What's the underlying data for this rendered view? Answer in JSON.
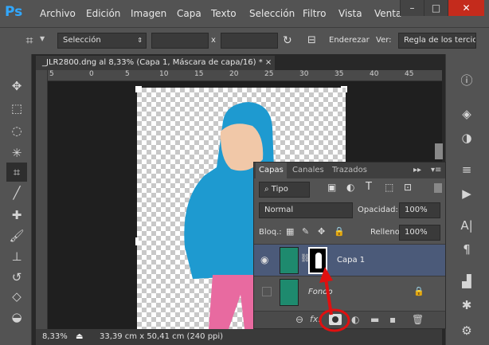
{
  "app": {
    "logo": "Ps"
  },
  "menu": [
    "Archivo",
    "Edición",
    "Imagen",
    "Capa",
    "Texto",
    "Selección",
    "Filtro",
    "Vista",
    "Venta"
  ],
  "window_controls": {
    "minimize": "–",
    "maximize": "□",
    "close": "✕"
  },
  "options_bar": {
    "mode_select": "Selección",
    "width_value": "",
    "x_label": "x",
    "height_value": "",
    "straighten_label": "Enderezar",
    "view_label": "Ver:",
    "view_select": "Regla de los tercios"
  },
  "document": {
    "tab_title": "_JLR2800.dng al 8,33% (Capa 1, Máscara de capa/16) *",
    "tab_close": "×",
    "ruler_numbers": [
      "5",
      "0",
      "5",
      "10",
      "15",
      "20",
      "25",
      "30",
      "35",
      "40",
      "45"
    ],
    "zoom": "8,33%",
    "doc_info": "33,39 cm x 50,41 cm (240 ppi)"
  },
  "layers_panel": {
    "tabs": [
      "Capas",
      "Canales",
      "Trazados"
    ],
    "filter_select": "Tipo",
    "blend_mode": "Normal",
    "opacity_label": "Opacidad:",
    "opacity_value": "100%",
    "lock_label": "Bloq.:",
    "fill_label": "Relleno:",
    "fill_value": "100%",
    "layers": [
      {
        "name": "Capa 1",
        "visible": true,
        "has_mask": true,
        "selected": true
      },
      {
        "name": "Fondo",
        "visible": false,
        "locked": true,
        "selected": false
      }
    ],
    "footer_fx": "fx."
  },
  "colors": {
    "ui_bg": "#535353",
    "menu_bg": "#535353",
    "doc_bg": "#1f1f1f",
    "selected_layer": "#4b5a79",
    "annotation_red": "#e01010",
    "jacket_blue": "#1e9ad0",
    "pants_pink": "#e86aa0"
  }
}
